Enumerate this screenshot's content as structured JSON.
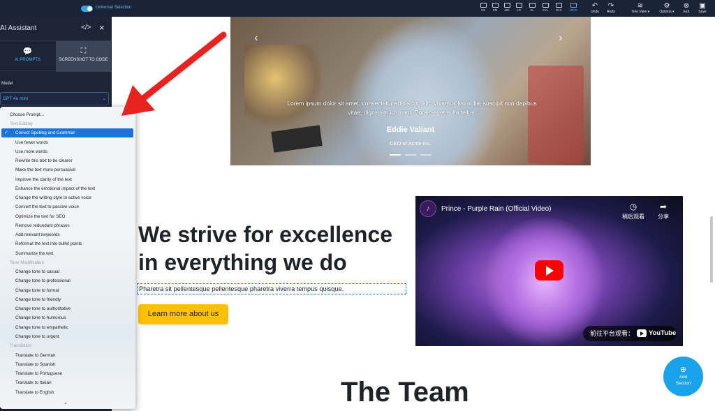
{
  "topbar": {
    "universal_selection": "Universal Selection",
    "devices": [
      "XS",
      "SM",
      "MD",
      "LG",
      "XL",
      "XXL",
      "R13",
      "100%"
    ],
    "undo": "Undo",
    "redo": "Redo",
    "tree_view": "Tree View ▾",
    "options": "Options ▾",
    "exit": "Exit",
    "save": "Save"
  },
  "sidebar": {
    "title": "AI Assistant",
    "tab_prompts": "AI PROMPTS",
    "tab_screenshot": "SCREENSHOT TO CODE",
    "model_label": "Model",
    "model_value": "GPT 4o mini"
  },
  "dropdown": {
    "choose": "Choose Prompt...",
    "group_editing": "Text Editing",
    "selected": "Correct Spelling and Grammar",
    "editing_items": [
      "Use fewer words",
      "Use more words",
      "Rewrite this text to be clearer",
      "Make the text more persuasive",
      "Improve the clarity of the text",
      "Enhance the emotional impact of the text",
      "Change the writing style to active voice",
      "Convert the text to passive voice",
      "Optimize the text for SEO",
      "Remove redundant phrases",
      "Add relevant keywords",
      "Reformat the text into bullet points",
      "Summarize the text"
    ],
    "group_tone": "Tone Modification",
    "tone_items": [
      "Change tone to casual",
      "Change tone to professional",
      "Change tone to formal",
      "Change tone to friendly",
      "Change tone to authoritative",
      "Change tone to humorous",
      "Change tone to empathetic",
      "Change tone to urgent"
    ],
    "group_translation": "Translation",
    "translation_items": [
      "Translate to German",
      "Translate to Spanish",
      "Translate to Portuguese",
      "Translate to Italian",
      "Translate to English"
    ]
  },
  "hero": {
    "quote": "Lorem ipsum dolor sit amet, consectetur adipiscing elit. Vivamus leo nulla, suscipit non dapibus vitae, dignissim id quam. Donec eget nulla tellus.",
    "name": "Eddie Valiant",
    "role": "CEO of Acme Inc."
  },
  "content": {
    "headline": "We strive for excellence in everything we do",
    "lead": "Pharetra sit pellentesque pellentesque pharetra viverra tempus quisque.",
    "button": "Learn more about us",
    "team_title": "The Team"
  },
  "video": {
    "title": "Prince - Purple Rain (Official Video)",
    "watch_later": "稍后观看",
    "share": "分享",
    "watch_on": "前往平台观看：",
    "youtube": "YouTube"
  },
  "add_section": {
    "line1": "Add",
    "line2": "Section"
  },
  "colors": {
    "accent": "#1aa3e8",
    "selected": "#1e73d8",
    "cta": "#fec006",
    "arrow": "#e8231f"
  }
}
